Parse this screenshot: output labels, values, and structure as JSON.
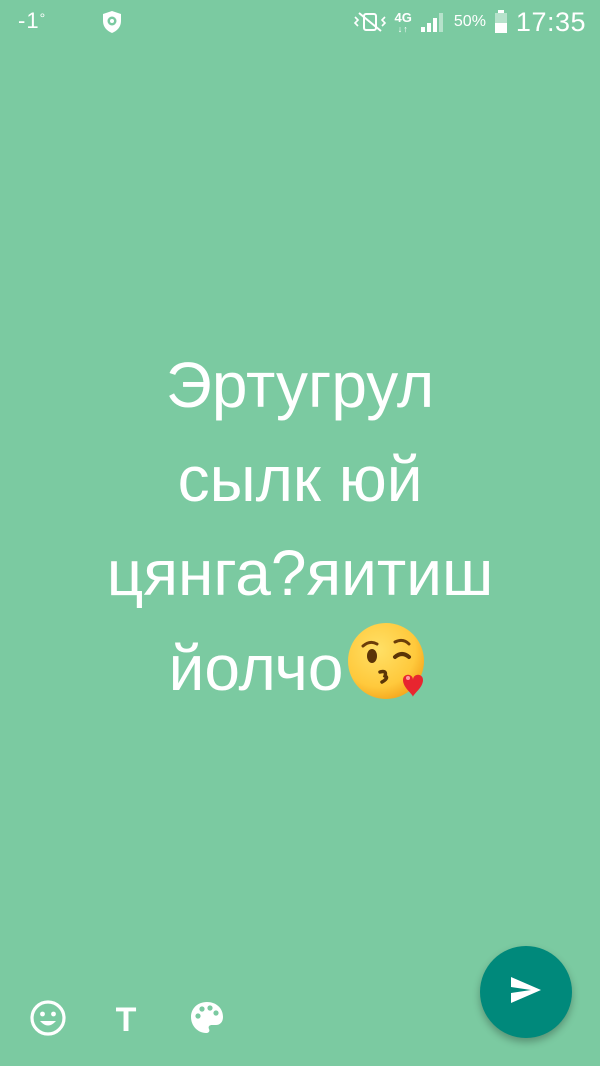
{
  "status_bar": {
    "temperature": "-1",
    "temperature_unit": "°",
    "network_type": "4G",
    "network_arrows": "↓↑",
    "battery_percent": "50%",
    "time": "17:35",
    "icons": [
      "shield-icon",
      "vibrate-mute-icon",
      "signal-icon",
      "battery-icon"
    ]
  },
  "status_text": {
    "lines": [
      "Эртугрул",
      "сылк юй",
      "цянга?яитиш",
      "йолчо"
    ],
    "trailing_emoji": "face-blowing-kiss-emoji"
  },
  "toolbar": {
    "emoji_button": "emoji-icon",
    "text_button_label": "T",
    "color_button": "palette-icon"
  },
  "send_button": {
    "icon": "send-icon"
  },
  "colors": {
    "background": "#7bcaa1",
    "fab": "#00897b",
    "text": "#ffffff"
  }
}
